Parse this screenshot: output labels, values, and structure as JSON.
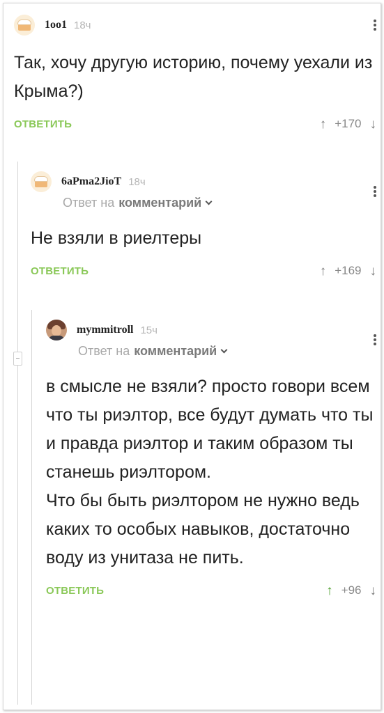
{
  "comments": [
    {
      "username": "1oo1",
      "time": "18ч",
      "text": "Так, хочу другую историю, почему уехали из Крыма?)",
      "reply_label": "ОТВЕТИТЬ",
      "score": "+170"
    },
    {
      "username": "6aPma2JioT",
      "time": "18ч",
      "reply_prefix": "Ответ на",
      "reply_link": "комментарий",
      "text": "Не взяли в риелтеры",
      "reply_label": "ОТВЕТИТЬ",
      "score": "+169"
    },
    {
      "username": "mymmitroll",
      "time": "15ч",
      "reply_prefix": "Ответ на",
      "reply_link": "комментарий",
      "text": "в смысле не взяли? просто говори всем что ты риэлтор, все будут думать что ты и правда риэлтор и таким образом ты станешь риэлтором.\nЧто бы быть риэлтором не нужно ведь каких то особых навыков, достаточно воду из унитаза не пить.",
      "reply_label": "ОТВЕТИТЬ",
      "score": "+96"
    }
  ],
  "icons": {
    "upvote": "↑",
    "downvote": "↓"
  },
  "colors": {
    "reply_green": "#8ac858",
    "text": "#222222",
    "muted": "#a8a8a8"
  }
}
